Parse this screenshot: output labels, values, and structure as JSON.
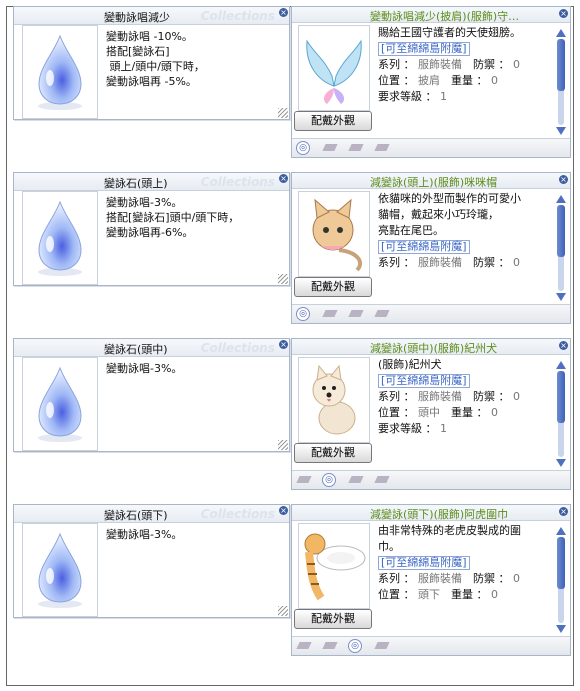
{
  "watermark": "Collections",
  "close_glyph": "×",
  "rows": [
    {
      "item": {
        "name": "變動詠唱減少",
        "desc": "變動詠唱 -10%。\n搭配[變詠石]\n 頭上/頭中/頭下時，\n變動詠唱再 -5%。",
        "icon": "blue-droplet-icon"
      },
      "costume": {
        "title": "變動詠唱減少(披肩)(服飾)守…",
        "lines": [
          "賜給王國守護者的天使翅膀。"
        ],
        "link": "[可至綿綿島附魔]",
        "stats": [
          [
            "系列",
            "服飾裝備",
            "防禦",
            "0"
          ],
          [
            "位置",
            "披肩",
            "重量",
            "0"
          ]
        ],
        "req": [
          "要求等級",
          "1"
        ],
        "button": "配戴外觀",
        "icon": "angel-wings-icon"
      }
    },
    {
      "item": {
        "name": "變詠石(頭上)",
        "desc": "變動詠唱-3%。\n搭配[變詠石]頭中/頭下時，\n變動詠唱再-6%。",
        "icon": "blue-droplet-icon"
      },
      "costume": {
        "title": "減變詠(頭上)(服飾)咪咪帽",
        "lines": [
          "依貓咪的外型而製作的可愛小",
          "貓帽，戴起來小巧玲瓏，",
          "亮點在尾巴。"
        ],
        "link": "[可至綿綿島附魔]",
        "stats": [
          [
            "系列",
            "服飾裝備",
            "防禦",
            "0"
          ]
        ],
        "req": null,
        "button": "配戴外觀",
        "icon": "cat-hat-icon"
      }
    },
    {
      "item": {
        "name": "變詠石(頭中)",
        "desc": "變動詠唱-3%。",
        "icon": "blue-droplet-icon"
      },
      "costume": {
        "title": "減變詠(頭中)(服飾)紀州犬",
        "lines": [
          "(服飾)紀州犬"
        ],
        "link": "[可至綿綿島附魔]",
        "stats": [
          [
            "系列",
            "服飾裝備",
            "防禦",
            "0"
          ],
          [
            "位置",
            "頭中",
            "重量",
            "0"
          ]
        ],
        "req": [
          "要求等級",
          "1"
        ],
        "button": "配戴外觀",
        "icon": "kishu-dog-icon"
      }
    },
    {
      "item": {
        "name": "變詠石(頭下)",
        "desc": "變動詠唱-3%。",
        "icon": "blue-droplet-icon"
      },
      "costume": {
        "title": "減變詠(頭下)(服飾)阿虎圍巾",
        "lines": [
          "由非常特殊的老虎皮製成的圍",
          "巾。"
        ],
        "link": "[可至綿綿島附魔]",
        "stats": [
          [
            "系列",
            "服飾裝備",
            "防禦",
            "0"
          ],
          [
            "位置",
            "頭下",
            "重量",
            "0"
          ]
        ],
        "req": null,
        "button": "配戴外觀",
        "icon": "tiger-scarf-icon"
      }
    }
  ]
}
